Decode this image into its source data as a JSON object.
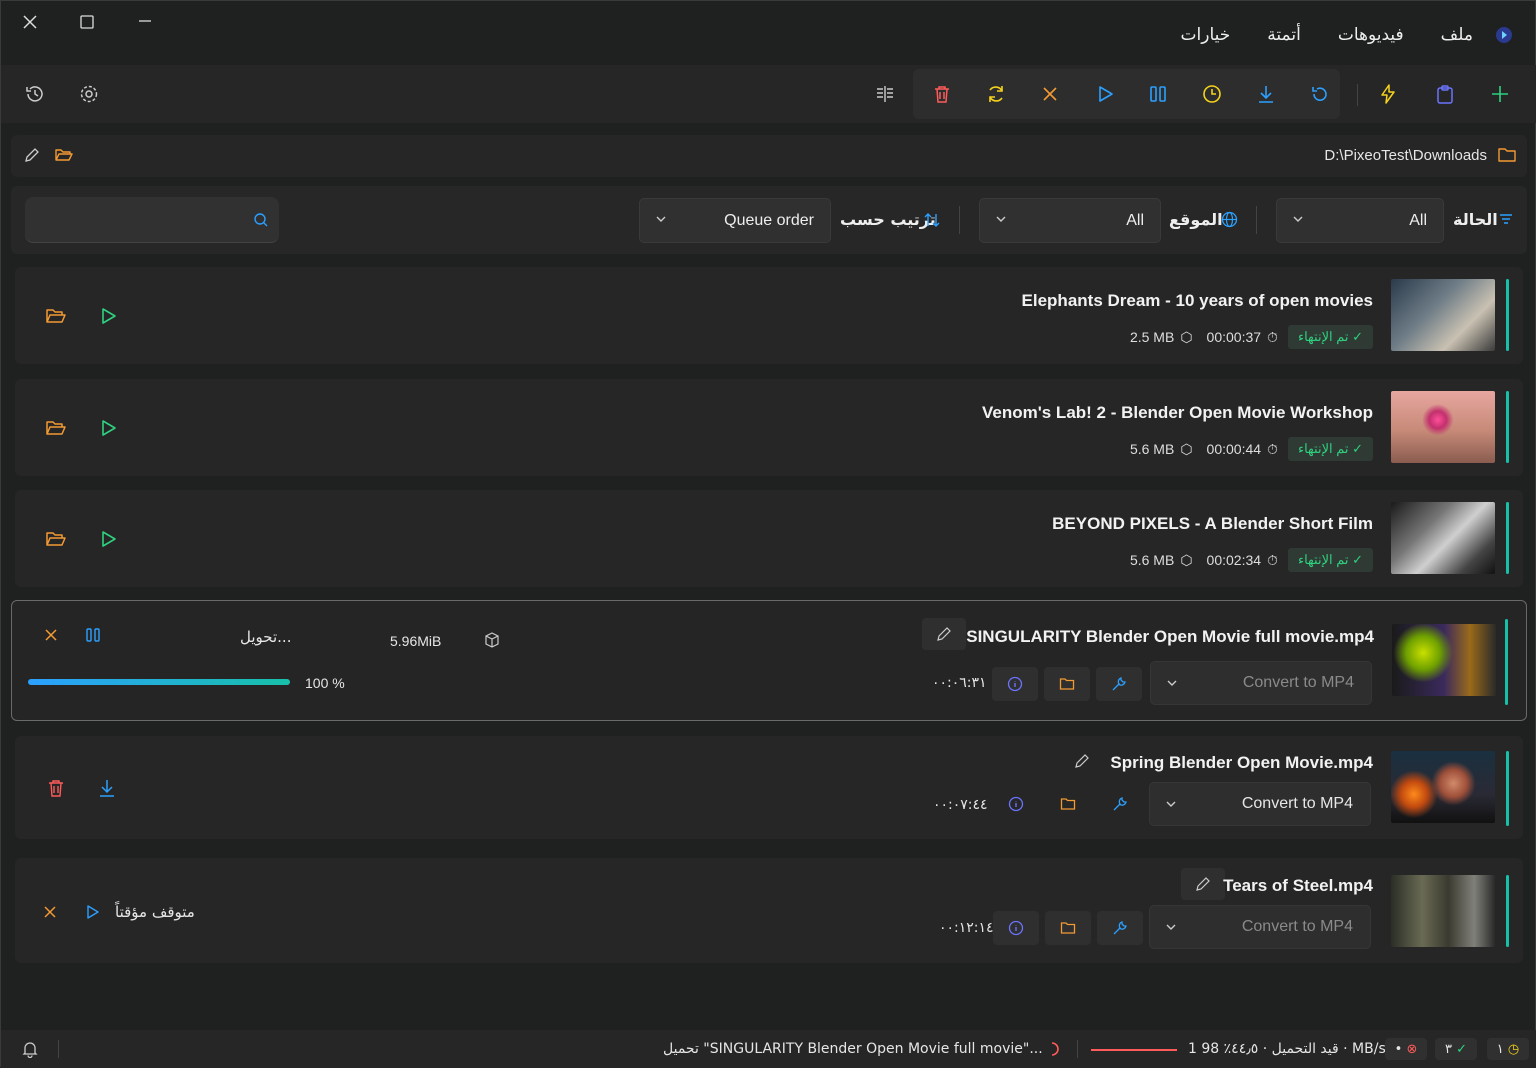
{
  "menu": {
    "items": [
      "ملف",
      "فيديوهات",
      "أتمتة",
      "خيارات"
    ]
  },
  "path": {
    "value": "D:\\PixeoTest\\Downloads"
  },
  "filters": {
    "status_label": "الحالة",
    "status_value": "All",
    "site_label": "الموقع",
    "site_value": "All",
    "sort_label": "ترتيب حسب",
    "sort_value": "Queue order",
    "search_placeholder": ""
  },
  "items": [
    {
      "title": "Elephants Dream - 10 years of open movies",
      "status": "تم الإنتهاء",
      "duration": "00:00:37",
      "size": "2.5 MB"
    },
    {
      "title": "Venom's Lab! 2 - Blender Open Movie Workshop",
      "status": "تم الإنتهاء",
      "duration": "00:00:44",
      "size": "5.6 MB"
    },
    {
      "title": "BEYOND PIXELS - A Blender Short Film",
      "status": "تم الإنتهاء",
      "duration": "00:02:34",
      "size": "5.6 MB"
    }
  ],
  "active": {
    "title": "SINGULARITY   Blender Open Movie full movie.mp4",
    "status": "تحويل...",
    "size": "5.96MiB",
    "progress": 1.0,
    "progress_text": "100 %",
    "duration": "٠٠:٠٦:٣١",
    "convert": "Convert to MP4"
  },
  "pending": [
    {
      "title": "Spring   Blender Open Movie.mp4",
      "duration": "٠٠:٠٧:٤٤",
      "convert": "Convert to MP4"
    },
    {
      "title": "Tears of Steel.mp4",
      "duration": "٠٠:١٢:١٤",
      "convert": "Convert to MP4",
      "status": "متوقف مؤقتاً"
    }
  ],
  "statusbar": {
    "downloading": "تحميل \"SINGULARITY   Blender Open Movie full movie\"...",
    "speed": "1 قيد التحميل · ٤٤٫٥٪ 98 · MB/s",
    "errors": "•",
    "done": "٣",
    "queued": "١"
  },
  "colors": {
    "accent": "#17c1a9",
    "success": "#2fd17f",
    "orange": "#f39a34",
    "blue": "#2ca0ff",
    "purple": "#6b73ff",
    "yellow": "#f5d31c",
    "red": "#ff5b5b"
  }
}
